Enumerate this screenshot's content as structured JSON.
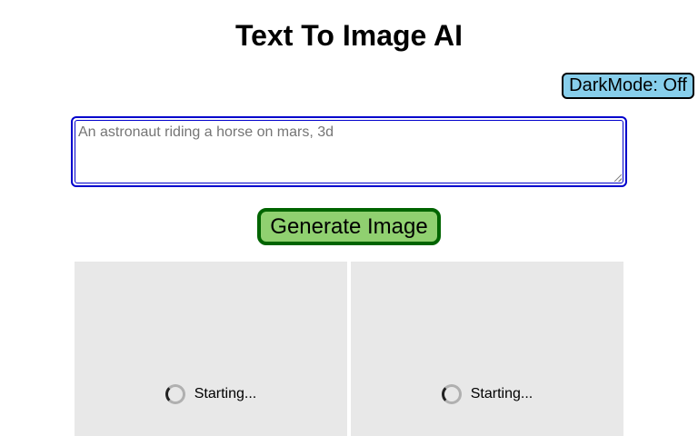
{
  "header": {
    "title": "Text To Image AI"
  },
  "controls": {
    "dark_mode_label": "DarkMode: Off",
    "prompt_placeholder": "An astronaut riding a horse on mars, 3d",
    "prompt_value": "",
    "generate_label": "Generate Image"
  },
  "results": [
    {
      "status": "Starting...",
      "icon": "spinner-icon"
    },
    {
      "status": "Starting...",
      "icon": "spinner-icon"
    }
  ],
  "colors": {
    "dark_mode_bg": "#87ceeb",
    "generate_bg": "#90d070",
    "generate_border": "#006400",
    "prompt_border": "#0000cc",
    "card_bg": "#e8e8e8"
  }
}
